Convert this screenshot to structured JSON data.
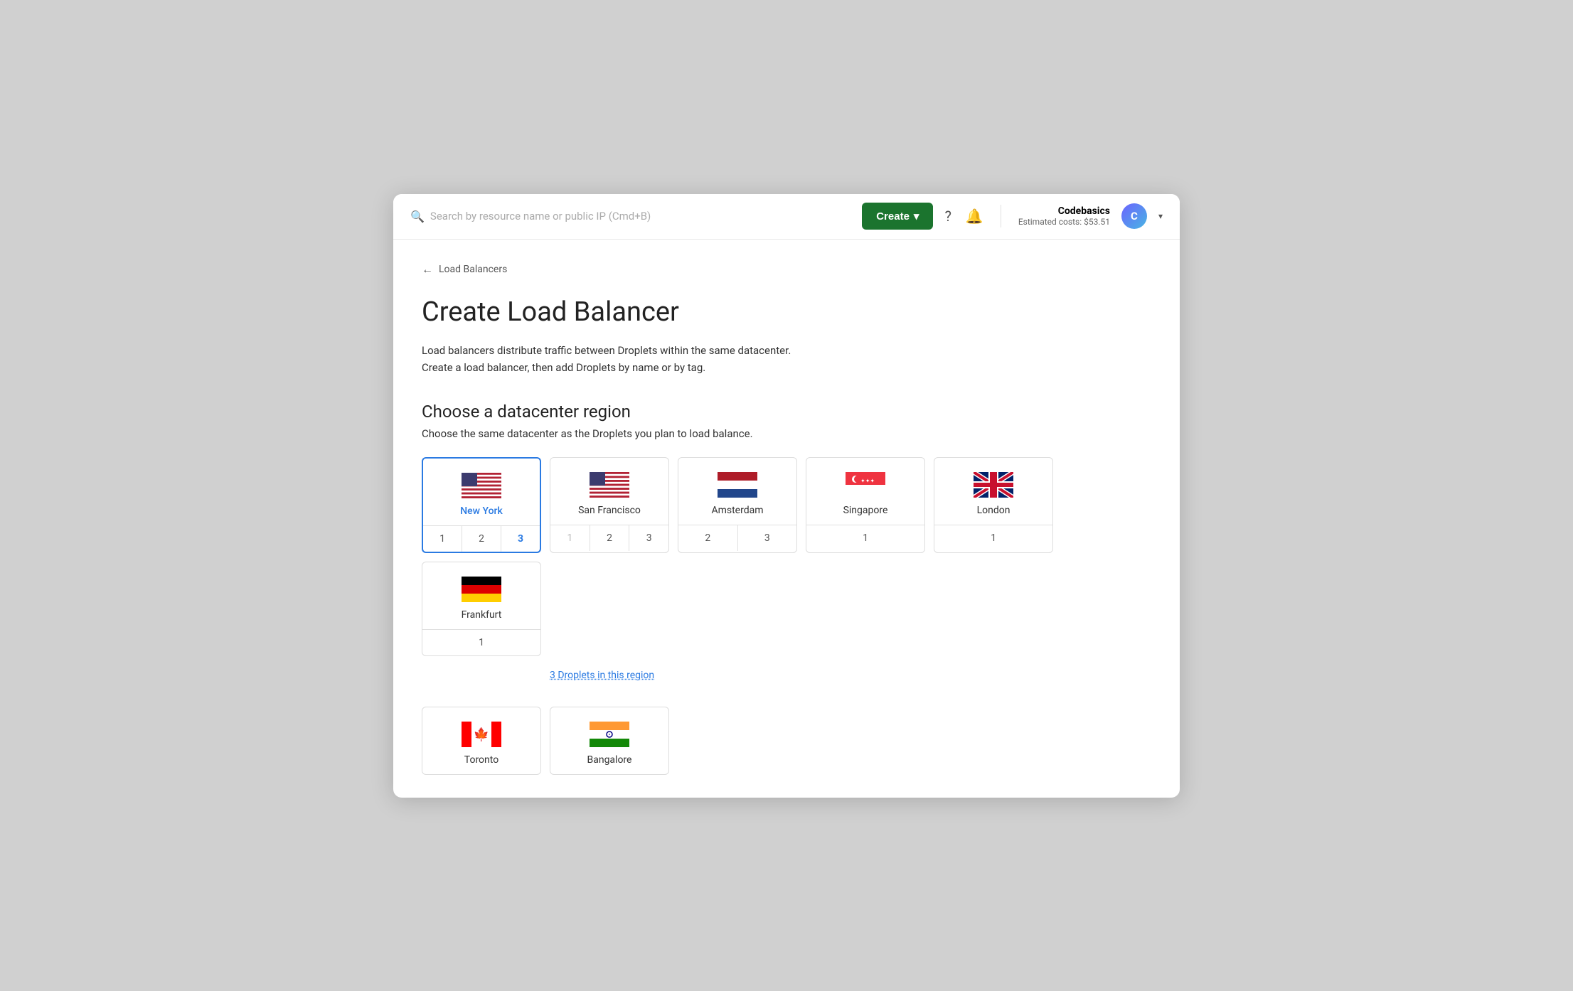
{
  "header": {
    "search_placeholder": "Search by resource name or public IP (Cmd+B)",
    "create_label": "Create",
    "help_icon": "?",
    "notification_icon": "🔔",
    "user": {
      "name": "Codebasics",
      "cost": "Estimated costs: $53.51",
      "avatar_letter": "C"
    }
  },
  "breadcrumb": {
    "back_label": "Load Balancers"
  },
  "page": {
    "title": "Create Load Balancer",
    "description_line1": "Load balancers distribute traffic between Droplets within the same datacenter.",
    "description_line2": "Create a load balancer, then add Droplets by name or by tag.",
    "section_title": "Choose a datacenter region",
    "section_subtitle": "Choose the same datacenter as the Droplets you plan to load balance.",
    "droplets_link": "3 Droplets in this region"
  },
  "regions": [
    {
      "id": "new-york",
      "name": "New York",
      "flag": "us",
      "selected": true,
      "numbers": [
        {
          "value": "1",
          "selected": false,
          "disabled": false
        },
        {
          "value": "2",
          "selected": false,
          "disabled": false
        },
        {
          "value": "3",
          "selected": true,
          "disabled": false
        }
      ]
    },
    {
      "id": "san-francisco",
      "name": "San Francisco",
      "flag": "us",
      "selected": false,
      "numbers": [
        {
          "value": "1",
          "selected": false,
          "disabled": true
        },
        {
          "value": "2",
          "selected": false,
          "disabled": false
        },
        {
          "value": "3",
          "selected": false,
          "disabled": false
        }
      ]
    },
    {
      "id": "amsterdam",
      "name": "Amsterdam",
      "flag": "nl",
      "selected": false,
      "numbers": [
        {
          "value": "2",
          "selected": false,
          "disabled": false
        },
        {
          "value": "3",
          "selected": false,
          "disabled": false
        }
      ]
    },
    {
      "id": "singapore",
      "name": "Singapore",
      "flag": "sg",
      "selected": false,
      "numbers": [
        {
          "value": "1",
          "selected": false,
          "disabled": false
        }
      ]
    },
    {
      "id": "london",
      "name": "London",
      "flag": "gb",
      "selected": false,
      "numbers": [
        {
          "value": "1",
          "selected": false,
          "disabled": false
        }
      ]
    },
    {
      "id": "frankfurt",
      "name": "Frankfurt",
      "flag": "de",
      "selected": false,
      "numbers": [
        {
          "value": "1",
          "selected": false,
          "disabled": false
        }
      ]
    },
    {
      "id": "toronto",
      "name": "Toronto",
      "flag": "ca",
      "selected": false,
      "numbers": []
    },
    {
      "id": "bangalore",
      "name": "Bangalore",
      "flag": "in",
      "selected": false,
      "numbers": []
    }
  ]
}
